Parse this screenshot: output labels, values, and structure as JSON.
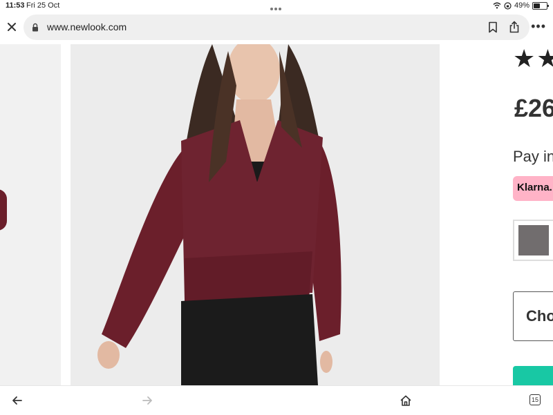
{
  "status_bar": {
    "time": "11:53",
    "date": "Fri 25 Oct",
    "battery_percent": "49%",
    "battery_level": 0.49
  },
  "browser": {
    "url": "www.newlook.com",
    "icons": [
      "close-icon",
      "lock-icon",
      "bookmark-icon",
      "share-icon",
      "more-icon"
    ]
  },
  "product": {
    "rating_stars_text": "★★",
    "price_text": "£26",
    "pay_in_text": "Pay in",
    "klarna_label": "Klarna.",
    "swatch_color": "#716d6e",
    "choose_label": "Cho",
    "cta_color": "#18c8a4",
    "image_color": "#6b1f2b"
  },
  "bottom_bar": {
    "tabs_count": "15",
    "icons": [
      "back-arrow-icon",
      "forward-arrow-icon",
      "home-icon",
      "tabs-icon"
    ]
  }
}
